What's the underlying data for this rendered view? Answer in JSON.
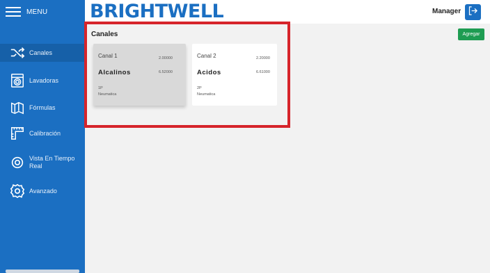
{
  "sidebar": {
    "menu_label": "MENU",
    "items": [
      {
        "label": "Canales",
        "icon": "shuffle-icon",
        "active": true
      },
      {
        "label": "Lavadoras",
        "icon": "washing-machine-icon"
      },
      {
        "label": "Fórmulas",
        "icon": "formula-icon"
      },
      {
        "label": "Calibración",
        "icon": "ruler-icon"
      },
      {
        "label": "Vista En Tiempo Real",
        "icon": "eye-icon"
      },
      {
        "label": "Avanzado",
        "icon": "gear-icon"
      }
    ]
  },
  "header": {
    "brand": "BRIGHTWELL",
    "user": "Manager",
    "logout_icon": "logout-icon"
  },
  "main": {
    "title": "Canales",
    "add_label": "Agregar",
    "cards": [
      {
        "name": "Canal 1",
        "value1": "2.00000",
        "type": "Alcalinos",
        "value2": "6.52000",
        "code": "1P",
        "mode": "Neumatica"
      },
      {
        "name": "Canal 2",
        "value1": "2.20000",
        "type": "Acidos",
        "value2": "6.61000",
        "code": "2P",
        "mode": "Neumatica"
      }
    ]
  },
  "colors": {
    "primary": "#1b6fc2",
    "sidebar_active": "#1660a8",
    "accent_green": "#1e9c52",
    "highlight_red": "#d6242b"
  }
}
